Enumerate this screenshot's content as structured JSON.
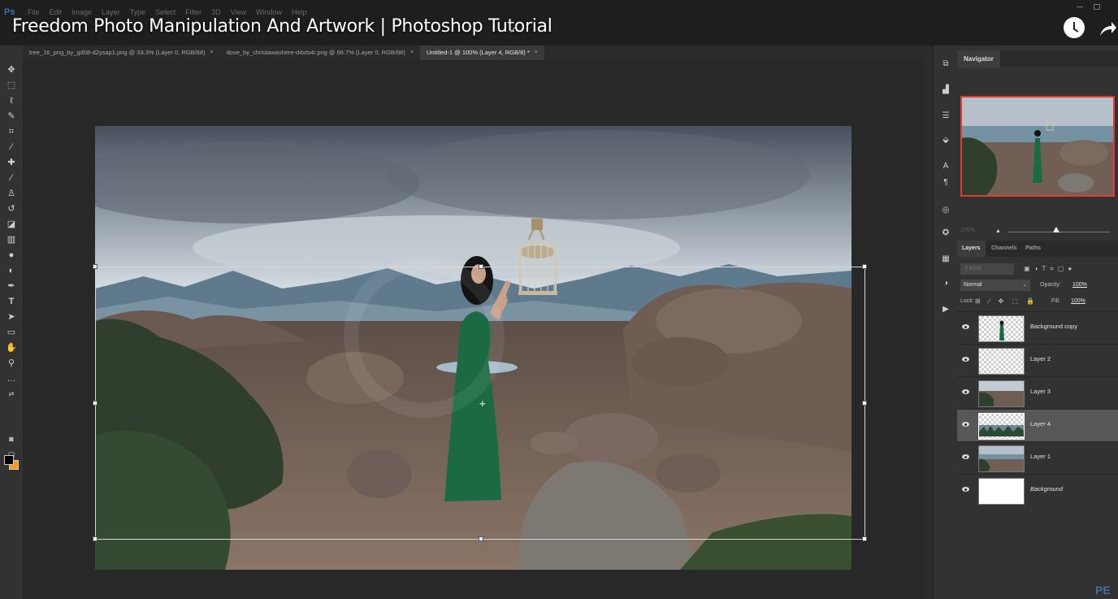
{
  "app": {
    "logo": "Ps",
    "menu": [
      "File",
      "Edit",
      "Image",
      "Layer",
      "Type",
      "Select",
      "Filter",
      "3D",
      "View",
      "Window",
      "Help"
    ]
  },
  "video": {
    "title": "Freedom Photo Manipulation And Artwork | Photoshop Tutorial",
    "badge": "PE"
  },
  "tabs": [
    {
      "label": "tree_16_png_by_gd08-d2ysap1.png @ 33.3% (Layer 0, RGB/8#)",
      "active": false
    },
    {
      "label": "dove_by_christawashere-d4xts4r.png @ 66.7% (Layer 0, RGB/8#)",
      "active": false
    },
    {
      "label": "Untitled-1 @ 100% (Layer 4, RGB/8) *",
      "active": true
    }
  ],
  "tab_close": "×",
  "navigator": {
    "tab": "Navigator",
    "zoom": "100%"
  },
  "layers_panel": {
    "tabs": [
      "Layers",
      "Channels",
      "Paths"
    ],
    "filter_placeholder": "Kind",
    "blend_mode": "Normal",
    "opacity_label": "Opacity:",
    "opacity_value": "100%",
    "lock_label": "Lock:",
    "fill_label": "Fill:",
    "fill_value": "100%",
    "layers": [
      {
        "name": "Background copy",
        "visible": true,
        "selected": false
      },
      {
        "name": "Layer 2",
        "visible": true,
        "selected": false
      },
      {
        "name": "Layer 3",
        "visible": true,
        "selected": false
      },
      {
        "name": "Layer 4",
        "visible": true,
        "selected": true
      },
      {
        "name": "Layer 1",
        "visible": true,
        "selected": false
      },
      {
        "name": "Background",
        "visible": true,
        "selected": false
      }
    ]
  },
  "colors": {
    "foreground": "#000000",
    "background": "#f39a1e",
    "navigator_frame": "#e03c31",
    "dress": "#1b6a43"
  },
  "tools": [
    "move-icon",
    "marquee-icon",
    "lasso-icon",
    "quick-select-icon",
    "crop-icon",
    "eyedropper-icon",
    "healing-icon",
    "brush-icon",
    "stamp-icon",
    "history-brush-icon",
    "eraser-icon",
    "gradient-icon",
    "blur-icon",
    "dodge-icon",
    "pen-icon",
    "type-icon",
    "path-select-icon",
    "rectangle-icon",
    "hand-icon",
    "zoom-icon",
    "more-tools-icon"
  ]
}
